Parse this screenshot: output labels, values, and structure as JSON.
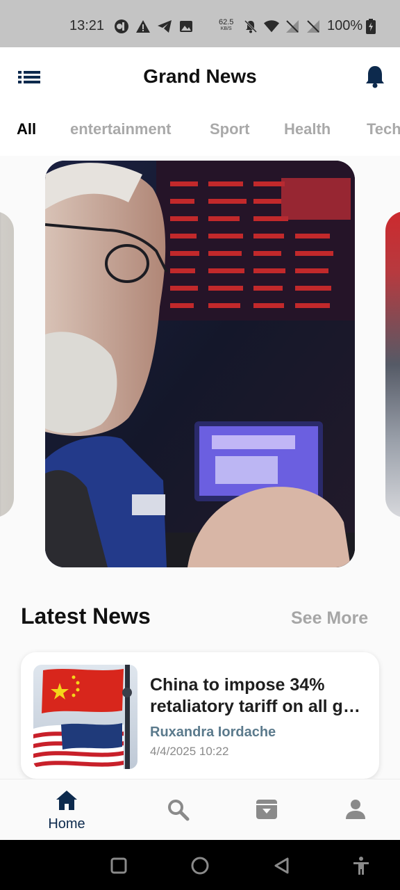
{
  "status_bar": {
    "time": "13:21",
    "net_speed_value": "62.5",
    "net_speed_unit": "KB/S",
    "battery": "100%",
    "icons": [
      "app-icon",
      "warning-icon",
      "telegram-icon",
      "image-icon",
      "mute-icon",
      "wifi-icon",
      "no-signal-icon",
      "no-signal-icon",
      "battery-charging-icon"
    ]
  },
  "header": {
    "title": "Grand News",
    "menu_icon": "menu-list-icon",
    "bell_icon": "bell-icon"
  },
  "tabs": [
    {
      "label": "All",
      "active": true
    },
    {
      "label": "entertainment",
      "active": false
    },
    {
      "label": "Sport",
      "active": false
    },
    {
      "label": "Health",
      "active": false
    },
    {
      "label": "Tech",
      "active": false
    }
  ],
  "latest": {
    "title": "Latest News",
    "see_more": "See More",
    "article": {
      "headline_line1": "China to impose 34%",
      "headline_line2": "retaliatory tariff on all g…",
      "author": "Ruxandra Iordache",
      "date": "4/4/2025 10:22"
    }
  },
  "bottom_nav": {
    "items": [
      {
        "icon": "home-icon",
        "label": "Home",
        "active": true
      },
      {
        "icon": "search-icon",
        "label": "",
        "active": false
      },
      {
        "icon": "archive-icon",
        "label": "",
        "active": false
      },
      {
        "icon": "person-icon",
        "label": "",
        "active": false
      }
    ]
  },
  "colors": {
    "accent": "#0d2a4d",
    "author": "#5b7a8c",
    "inactive_tab": "#a9a9a9"
  }
}
